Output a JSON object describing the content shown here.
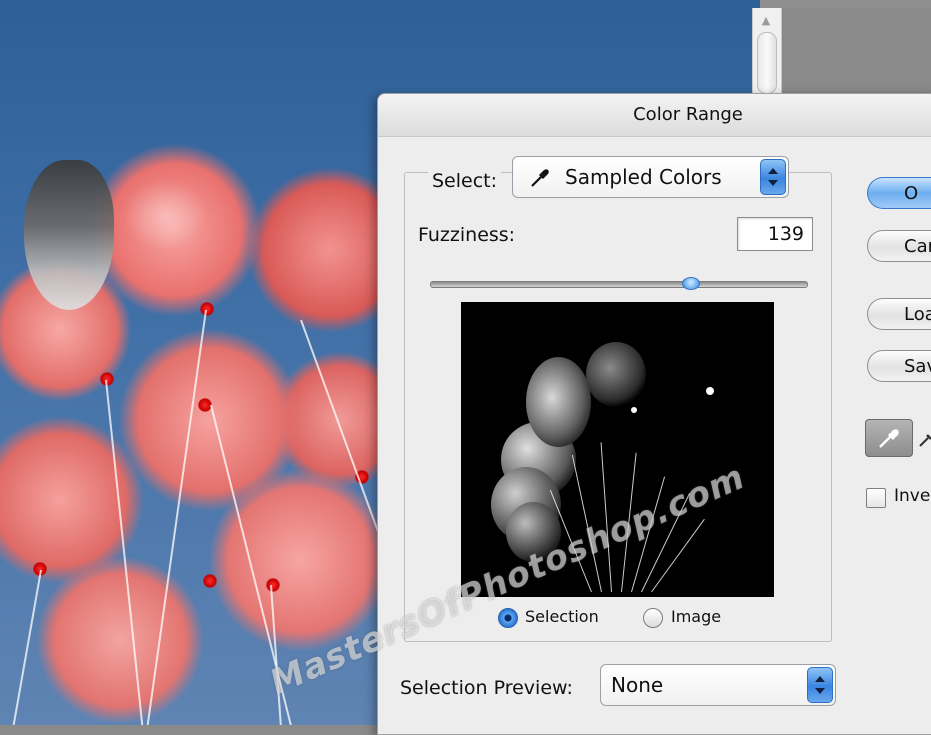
{
  "dialog": {
    "title": "Color Range",
    "select_label": "Select:",
    "select_value": "Sampled Colors",
    "fuzziness_label": "Fuzziness:",
    "fuzziness_value": "139",
    "fuzziness_fraction": 0.69,
    "radio_selection": "Selection",
    "radio_image": "Image",
    "radio_selected": "Selection",
    "selection_preview_label": "Selection Preview:",
    "selection_preview_value": "None",
    "buttons": {
      "ok": "O",
      "cancel": "Car",
      "load": "Loa",
      "save": "Sav"
    },
    "invert_label": "Inve"
  },
  "watermark": "MastersOfPhotoshop.com",
  "colors": {
    "accent_blue": "#3a86e0",
    "dialog_bg": "#ededed",
    "preview_bg": "#000000"
  }
}
